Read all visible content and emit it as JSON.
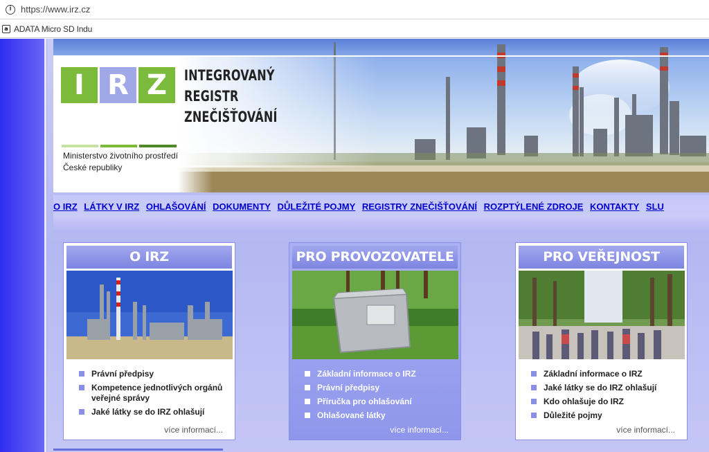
{
  "browser": {
    "url": "https://www.irz.cz",
    "bookmark": "ADATA Micro SD Indu"
  },
  "header": {
    "logo_letters": [
      "I",
      "R",
      "Z"
    ],
    "title_line1": "INTEGROVANÝ REGISTR",
    "title_line2": "ZNEČIŠŤOVÁNÍ",
    "ministry_line1": "Ministerstvo životního prostředí",
    "ministry_line2": "České republiky",
    "colors": {
      "logo_green": "#7cba3c",
      "logo_blue": "#a0a8e8",
      "dark_green": "#4e8a2a"
    }
  },
  "nav": {
    "items": [
      "O IRZ",
      "LÁTKY V IRZ",
      "OHLAŠOVÁNÍ",
      "DOKUMENTY",
      "DŮLEŽITÉ POJMY",
      "REGISTRY ZNEČIŠŤOVÁNÍ",
      "ROZPTÝLENÉ ZDROJE",
      "KONTAKTY",
      "SLU"
    ]
  },
  "cards": [
    {
      "title": "O IRZ",
      "items": [
        "Právní předpisy",
        "Kompetence jednotlivých orgánů veřejné správy",
        "Jaké látky se do IRZ ohlašují"
      ],
      "more": "více informací..."
    },
    {
      "title": "PRO PROVOZOVATELE",
      "items": [
        "Základní informace o IRZ",
        "Právní předpisy",
        "Příručka pro ohlašování",
        "Ohlašované látky"
      ],
      "more": "více informací..."
    },
    {
      "title": "PRO VEŘEJNOST",
      "items": [
        "Základní informace o IRZ",
        "Jaké látky se do IRZ ohlašují",
        "Kdo ohlašuje do IRZ",
        "Důležité pojmy"
      ],
      "more": "více informací..."
    }
  ]
}
